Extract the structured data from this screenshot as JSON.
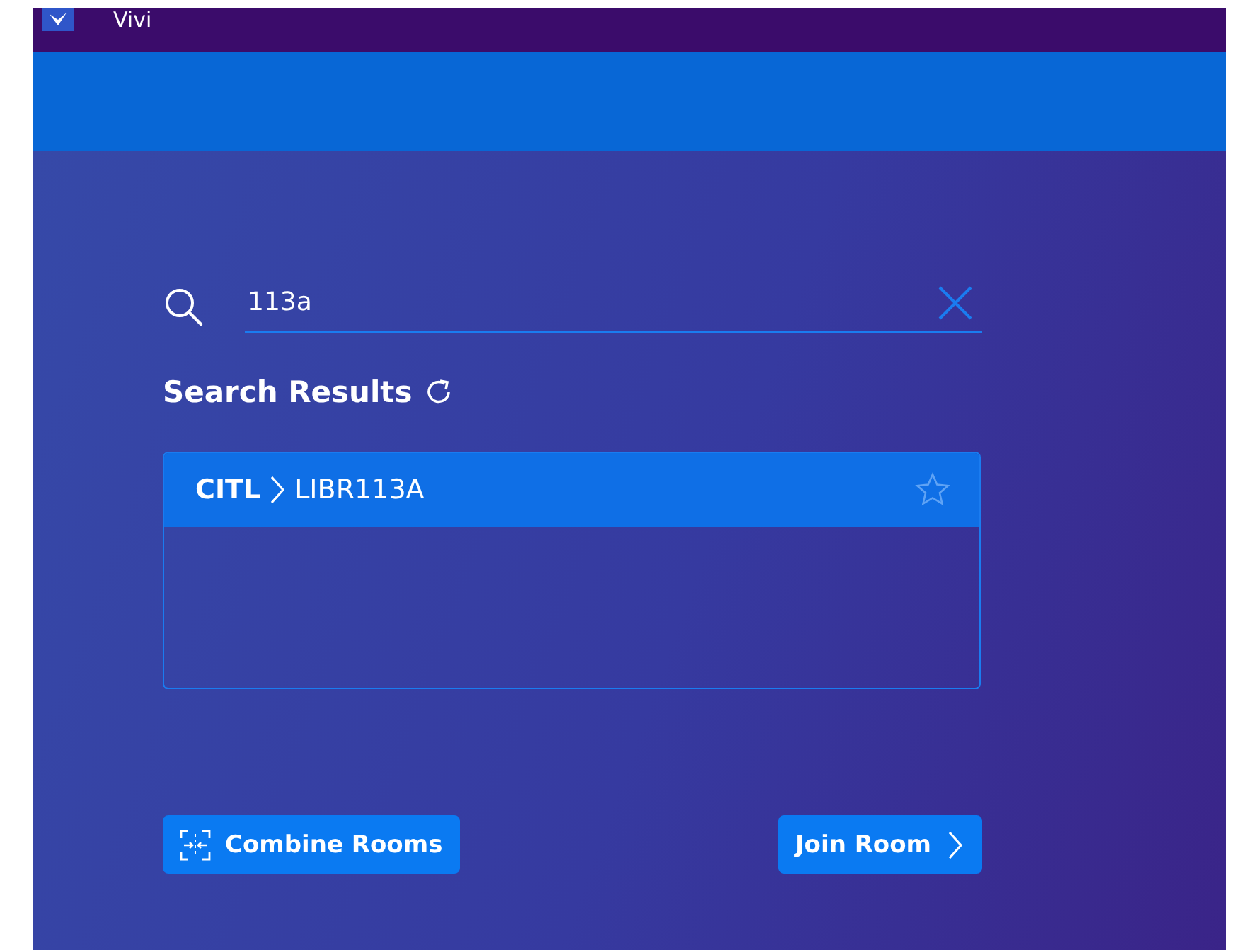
{
  "window": {
    "title": "Vivi"
  },
  "search": {
    "value": "113a"
  },
  "results": {
    "heading": "Search Results",
    "items": [
      {
        "parent": "CITL",
        "room": "LIBR113A",
        "selected": true,
        "favorite": false
      }
    ]
  },
  "buttons": [
    {
      "kind": "combine",
      "label": "Combine Rooms"
    },
    {
      "kind": "join",
      "label": "Join Room"
    }
  ]
}
